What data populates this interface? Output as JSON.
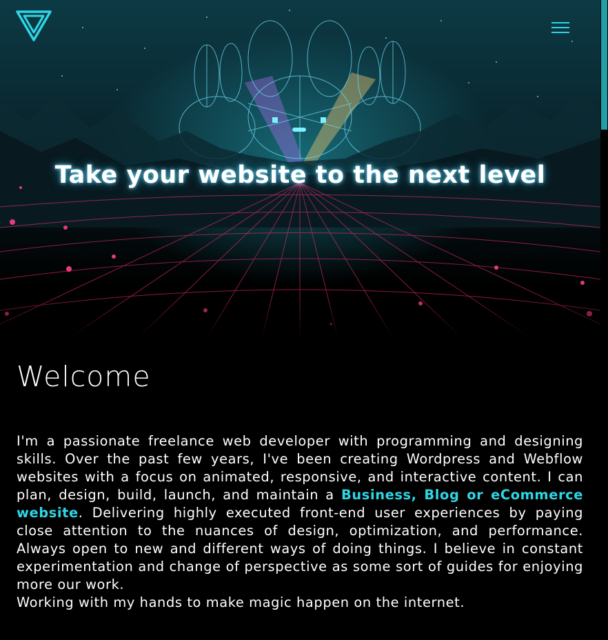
{
  "header": {
    "logo_icon": "triangle-v-logo-icon",
    "menu_icon": "hamburger-menu-icon",
    "accent_color": "#2fd6e6"
  },
  "hero": {
    "title": "Take your website to the next level"
  },
  "welcome": {
    "heading": "Welcome",
    "intro_before_link": "I'm a passionate freelance web developer with programming and designing skills. Over the past few years, I've been creating Wordpress and Webflow websites with a focus on animated, responsive, and interactive content. I can plan, design, build, launch, and maintain a ",
    "intro_link": "Business, Blog or eCommerce website",
    "intro_after_link": ". Delivering highly executed front-end user experiences by paying close attention to the nuances of design, optimization, and performance. Always open to new and different ways of doing things. I believe in constant experimentation and change of perspective as some sort of guides for enjoying more our work.",
    "closing_line": "Working with my hands to make magic happen on the internet."
  }
}
